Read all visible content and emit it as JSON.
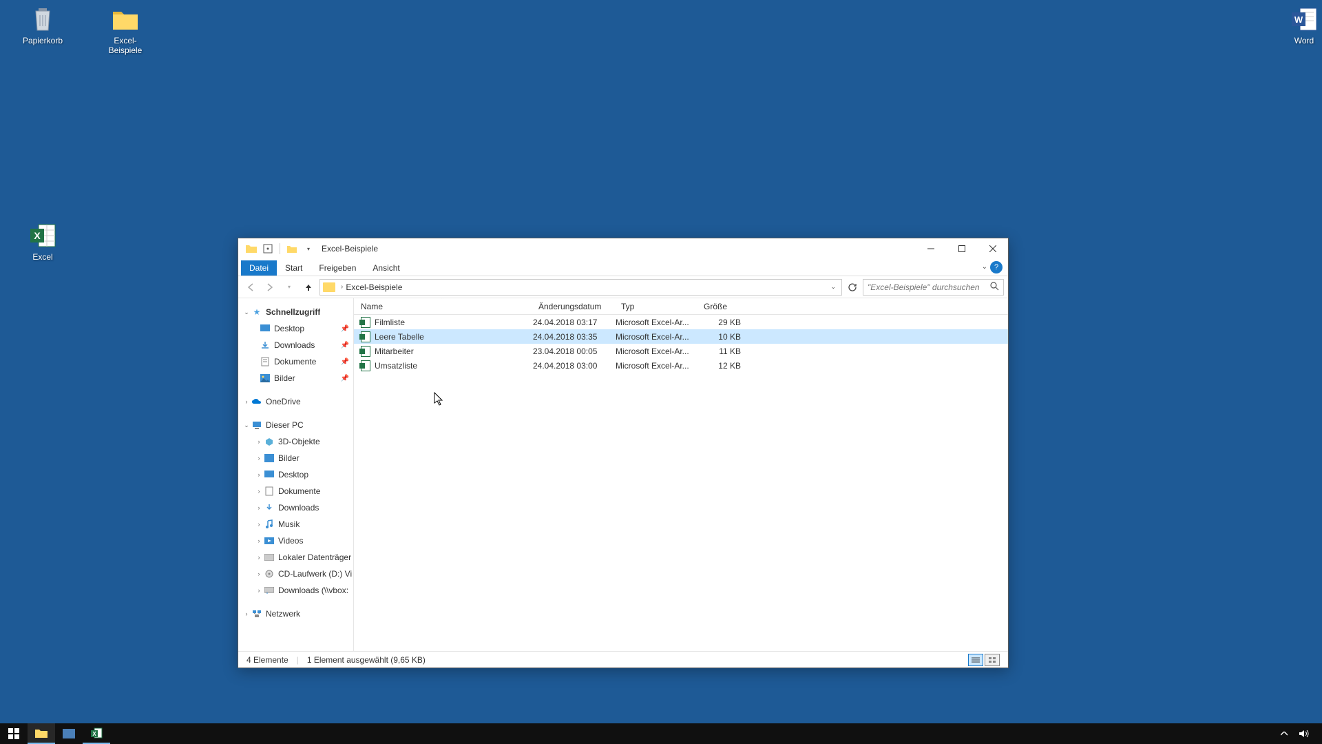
{
  "desktop": {
    "icons": {
      "recycle": "Papierkorb",
      "folder": "Excel-Beispiele",
      "excel": "Excel",
      "word": "Word"
    }
  },
  "window": {
    "title": "Excel-Beispiele",
    "tabs": {
      "file": "Datei",
      "start": "Start",
      "share": "Freigeben",
      "view": "Ansicht"
    },
    "breadcrumb": "Excel-Beispiele",
    "search_placeholder": "\"Excel-Beispiele\" durchsuchen",
    "columns": {
      "name": "Name",
      "date": "Änderungsdatum",
      "type": "Typ",
      "size": "Größe"
    },
    "files": [
      {
        "name": "Filmliste",
        "date": "24.04.2018 03:17",
        "type": "Microsoft Excel-Ar...",
        "size": "29 KB"
      },
      {
        "name": "Leere Tabelle",
        "date": "24.04.2018 03:35",
        "type": "Microsoft Excel-Ar...",
        "size": "10 KB"
      },
      {
        "name": "Mitarbeiter",
        "date": "23.04.2018 00:05",
        "type": "Microsoft Excel-Ar...",
        "size": "11 KB"
      },
      {
        "name": "Umsatzliste",
        "date": "24.04.2018 03:00",
        "type": "Microsoft Excel-Ar...",
        "size": "12 KB"
      }
    ],
    "status": {
      "count": "4 Elemente",
      "selection": "1 Element ausgewählt (9,65 KB)"
    }
  },
  "nav": {
    "quick": "Schnellzugriff",
    "desktop": "Desktop",
    "downloads": "Downloads",
    "documents": "Dokumente",
    "pictures": "Bilder",
    "onedrive": "OneDrive",
    "thispc": "Dieser PC",
    "objects3d": "3D-Objekte",
    "pictures2": "Bilder",
    "desktop2": "Desktop",
    "documents2": "Dokumente",
    "downloads2": "Downloads",
    "music": "Musik",
    "videos": "Videos",
    "localdisk": "Lokaler Datenträger",
    "cddrive": "CD-Laufwerk (D:) Vi",
    "netdl": "Downloads (\\\\vbox:",
    "network": "Netzwerk"
  }
}
